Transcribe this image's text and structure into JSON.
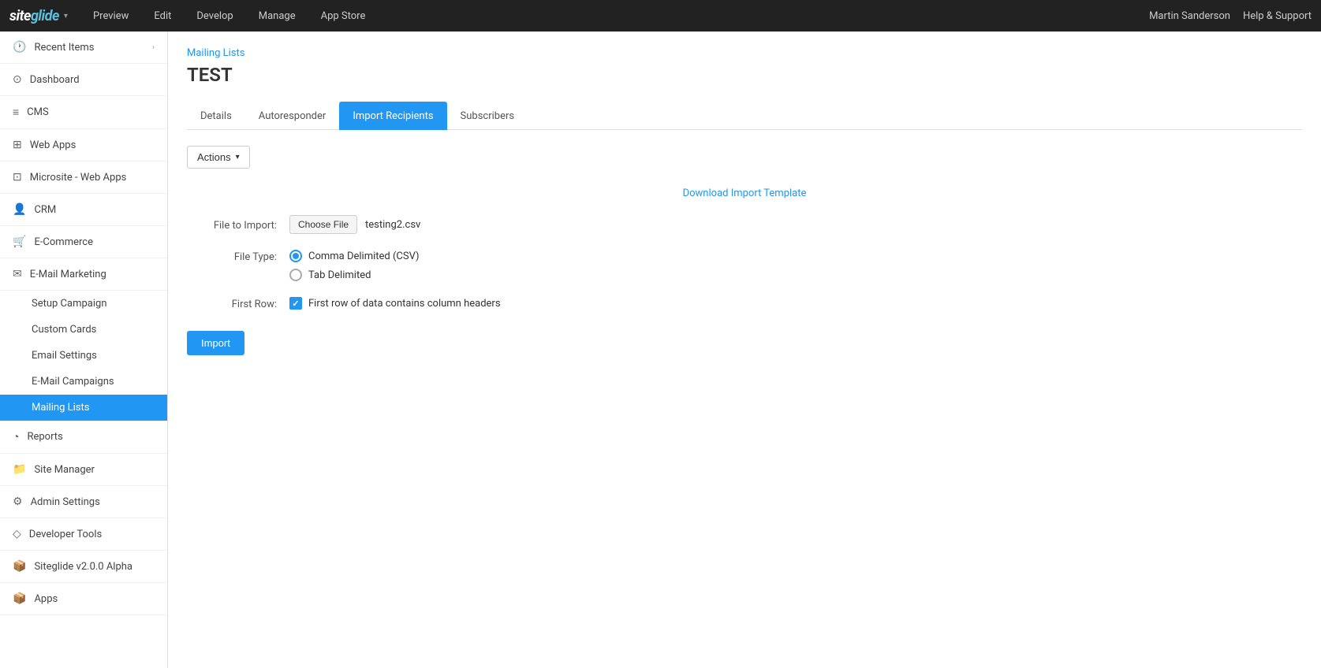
{
  "topNav": {
    "logoSite": "site",
    "logoGlide": "glide",
    "logoFull": "siteglide",
    "dropdownArrow": "▾",
    "navItems": [
      {
        "id": "preview",
        "label": "Preview"
      },
      {
        "id": "edit",
        "label": "Edit"
      },
      {
        "id": "develop",
        "label": "Develop"
      },
      {
        "id": "manage",
        "label": "Manage"
      },
      {
        "id": "appstore",
        "label": "App Store"
      }
    ],
    "user": "Martin Sanderson",
    "help": "Help & Support"
  },
  "sidebar": {
    "recentItems": {
      "label": "Recent Items",
      "arrow": "›"
    },
    "items": [
      {
        "id": "dashboard",
        "label": "Dashboard",
        "icon": "⊙"
      },
      {
        "id": "cms",
        "label": "CMS",
        "icon": "≡"
      },
      {
        "id": "webapps",
        "label": "Web Apps",
        "icon": "⊞"
      },
      {
        "id": "microsite",
        "label": "Microsite - Web Apps",
        "icon": "⊡"
      },
      {
        "id": "crm",
        "label": "CRM",
        "icon": "👤"
      },
      {
        "id": "ecommerce",
        "label": "E-Commerce",
        "icon": "🛒"
      },
      {
        "id": "emailmarketing",
        "label": "E-Mail Marketing",
        "icon": "✉",
        "expanded": true
      }
    ],
    "emailSubItems": [
      {
        "id": "setup-campaign",
        "label": "Setup Campaign",
        "active": false
      },
      {
        "id": "custom-cards",
        "label": "Custom Cards",
        "active": false
      },
      {
        "id": "email-settings",
        "label": "Email Settings",
        "active": false
      },
      {
        "id": "email-campaigns",
        "label": "E-Mail Campaigns",
        "active": false
      },
      {
        "id": "mailing-lists",
        "label": "Mailing Lists",
        "active": true
      }
    ],
    "bottomItems": [
      {
        "id": "reports",
        "label": "Reports",
        "icon": "◔"
      },
      {
        "id": "site-manager",
        "label": "Site Manager",
        "icon": "📁"
      },
      {
        "id": "admin-settings",
        "label": "Admin Settings",
        "icon": "⚙"
      },
      {
        "id": "developer-tools",
        "label": "Developer Tools",
        "icon": "◇"
      },
      {
        "id": "siteglide-version",
        "label": "Siteglide v2.0.0 Alpha",
        "icon": "📦"
      },
      {
        "id": "apps",
        "label": "Apps",
        "icon": "📦"
      }
    ]
  },
  "content": {
    "breadcrumb": "Mailing Lists",
    "title": "TEST",
    "tabs": [
      {
        "id": "details",
        "label": "Details",
        "active": false
      },
      {
        "id": "autoresponder",
        "label": "Autoresponder",
        "active": false
      },
      {
        "id": "import-recipients",
        "label": "Import Recipients",
        "active": true
      },
      {
        "id": "subscribers",
        "label": "Subscribers",
        "active": false
      }
    ],
    "actionsButton": "Actions",
    "actionsArrow": "▾",
    "downloadLink": "Download Import Template",
    "form": {
      "fileToImportLabel": "File to Import:",
      "chooseFileBtn": "Choose File",
      "selectedFile": "testing2.csv",
      "fileTypeLabel": "File Type:",
      "fileTypeOptions": [
        {
          "id": "csv",
          "label": "Comma Delimited (CSV)",
          "checked": true
        },
        {
          "id": "tab",
          "label": "Tab Delimited",
          "checked": false
        }
      ],
      "firstRowLabel": "First Row:",
      "firstRowCheckbox": "First row of data contains column headers",
      "firstRowChecked": true
    },
    "importButton": "Import"
  }
}
